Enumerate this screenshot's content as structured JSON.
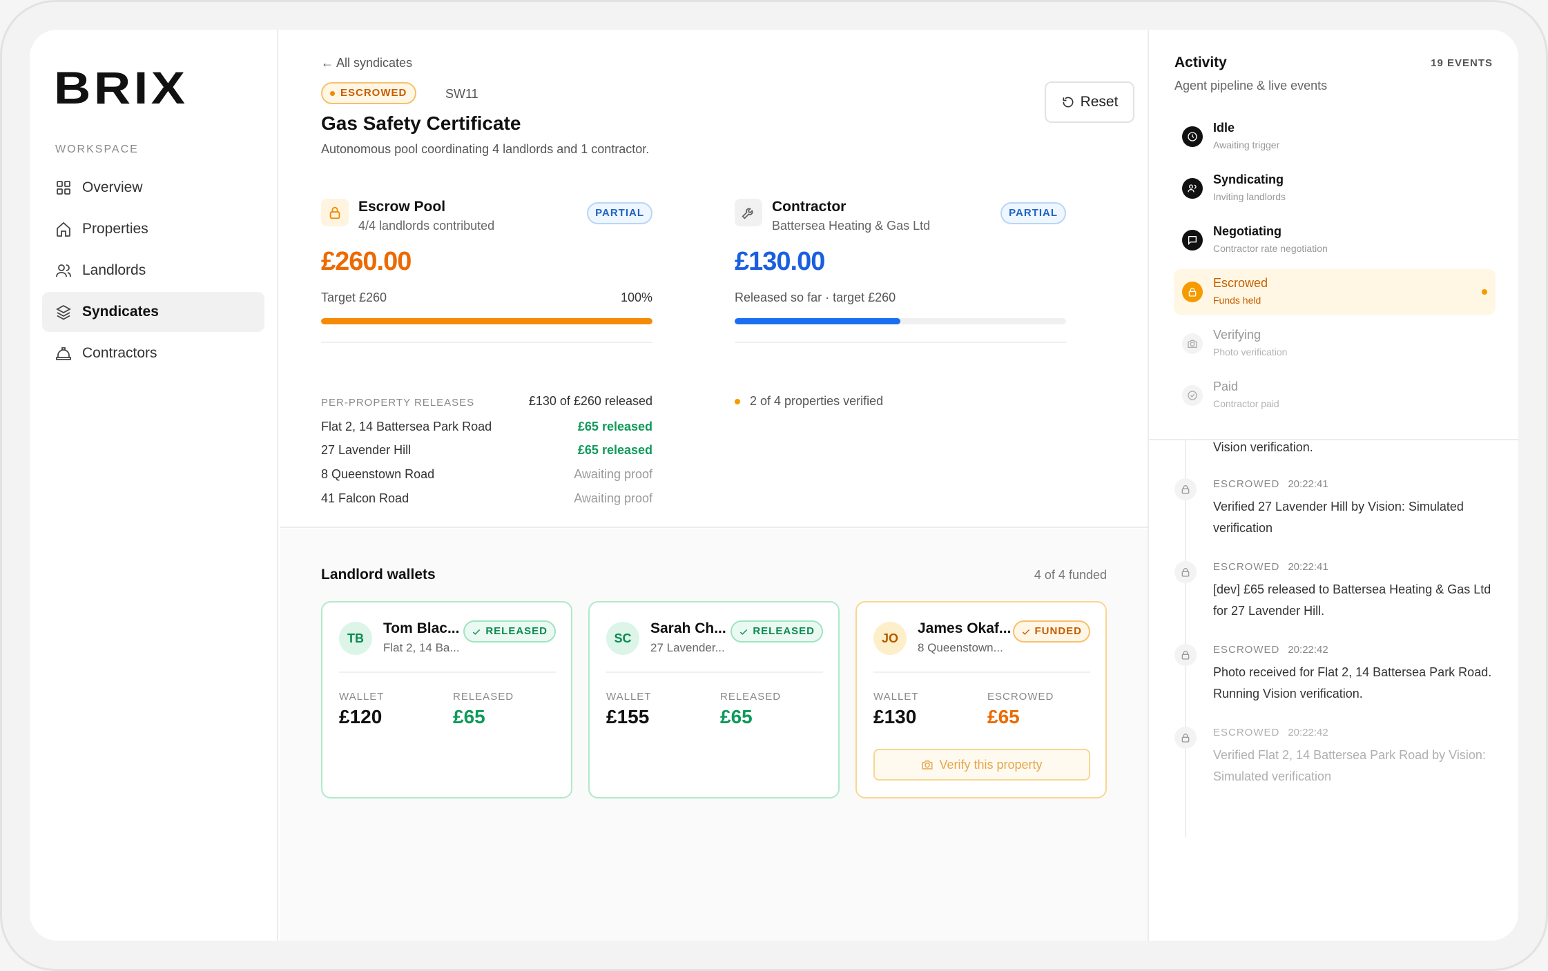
{
  "brand": "BRIX",
  "sidebar": {
    "section_label": "WORKSPACE",
    "items": [
      {
        "label": "Overview",
        "icon": "grid-icon"
      },
      {
        "label": "Properties",
        "icon": "home-icon"
      },
      {
        "label": "Landlords",
        "icon": "users-icon"
      },
      {
        "label": "Syndicates",
        "icon": "layers-icon",
        "active": true
      },
      {
        "label": "Contractors",
        "icon": "hardhat-icon"
      }
    ]
  },
  "header": {
    "back_link": "All syndicates",
    "status": "ESCROWED",
    "code": "SW11",
    "title": "Gas Safety Certificate",
    "subtitle": "Autonomous pool coordinating 4 landlords and 1 contractor.",
    "reset_label": "Reset"
  },
  "escrow_pool": {
    "title": "Escrow Pool",
    "subtitle": "4/4 landlords contributed",
    "badge": "PARTIAL",
    "amount": "£260.00",
    "target": "Target £260",
    "percent_label": "100%",
    "progress": 1.0,
    "releases_label": "PER-PROPERTY RELEASES",
    "releases_summary": "£130 of £260 released",
    "releases": [
      {
        "address": "Flat 2, 14 Battersea Park Road",
        "status": "£65 released",
        "released": true
      },
      {
        "address": "27 Lavender Hill",
        "status": "£65 released",
        "released": true
      },
      {
        "address": "8 Queenstown Road",
        "status": "Awaiting proof",
        "released": false
      },
      {
        "address": "41 Falcon Road",
        "status": "Awaiting proof",
        "released": false
      }
    ]
  },
  "contractor": {
    "title": "Contractor",
    "subtitle": "Battersea Heating & Gas Ltd",
    "badge": "PARTIAL",
    "amount": "£130.00",
    "released_text": "Released so far · target £260",
    "progress": 0.5,
    "verified_text": "2 of 4 properties verified"
  },
  "wallets": {
    "title": "Landlord wallets",
    "count": "4 of 4 funded",
    "items": [
      {
        "initials": "TB",
        "name": "Tom Blac...",
        "address": "Flat 2, 14 Ba...",
        "badge": "RELEASED",
        "wallet_label": "WALLET",
        "wallet": "£120",
        "second_label": "RELEASED",
        "second": "£65"
      },
      {
        "initials": "SC",
        "name": "Sarah Ch...",
        "address": "27 Lavender...",
        "badge": "RELEASED",
        "wallet_label": "WALLET",
        "wallet": "£155",
        "second_label": "RELEASED",
        "second": "£65"
      },
      {
        "initials": "JO",
        "name": "James Okaf...",
        "address": "8 Queenstown...",
        "badge": "FUNDED",
        "wallet_label": "WALLET",
        "wallet": "£130",
        "second_label": "ESCROWED",
        "second": "£65",
        "action": "Verify this property"
      }
    ]
  },
  "activity": {
    "title": "Activity",
    "count": "19 EVENTS",
    "subtitle": "Agent pipeline & live events",
    "stages": [
      {
        "name": "Idle",
        "desc": "Awaiting trigger",
        "state": "done",
        "icon": "clock-icon"
      },
      {
        "name": "Syndicating",
        "desc": "Inviting landlords",
        "state": "done",
        "icon": "users-icon"
      },
      {
        "name": "Negotiating",
        "desc": "Contractor rate negotiation",
        "state": "done",
        "icon": "message-icon"
      },
      {
        "name": "Escrowed",
        "desc": "Funds held",
        "state": "active",
        "icon": "lock-icon"
      },
      {
        "name": "Verifying",
        "desc": "Photo verification",
        "state": "todo",
        "icon": "camera-icon"
      },
      {
        "name": "Paid",
        "desc": "Contractor paid",
        "state": "todo",
        "icon": "check-circle-icon"
      }
    ],
    "feed_top_text": "Vision verification.",
    "events": [
      {
        "tag": "ESCROWED",
        "time": "20:22:41",
        "text": "Verified 27 Lavender Hill by Vision: Simulated verification"
      },
      {
        "tag": "ESCROWED",
        "time": "20:22:41",
        "text": "[dev] £65 released to Battersea Heating & Gas Ltd for 27 Lavender Hill."
      },
      {
        "tag": "ESCROWED",
        "time": "20:22:42",
        "text": "Photo received for Flat 2, 14 Battersea Park Road. Running Vision verification."
      },
      {
        "tag": "ESCROWED",
        "time": "20:22:42",
        "text": "Verified Flat 2, 14 Battersea Park Road by Vision: Simulated verification"
      }
    ]
  },
  "colors": {
    "accent_orange": "#ec6a00",
    "accent_blue": "#1b5fe0",
    "released_green": "#0f9a5a"
  }
}
